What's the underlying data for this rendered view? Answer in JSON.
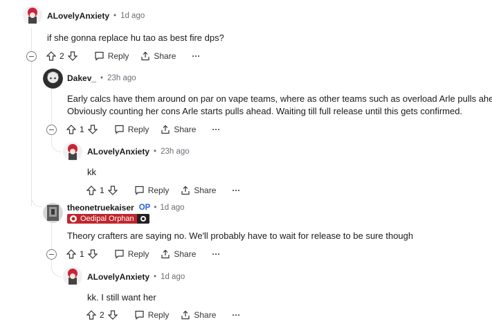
{
  "comments": [
    {
      "author": "ALovelyAnxiety",
      "time": "1d ago",
      "text": "if she gonna replace hu tao as best fire dps?",
      "votes": "2"
    },
    {
      "author": "Dakev_",
      "time": "23h ago",
      "lines": [
        "Early calcs have them around on par on vape teams, where as other teams such as overload Arle pulls ahead.",
        "Obviously counting her cons Arle starts pulls ahead. Waiting till full release until this gets confirmed."
      ],
      "votes": "1"
    },
    {
      "author": "ALovelyAnxiety",
      "time": "23h ago",
      "text": "kk",
      "votes": "1"
    },
    {
      "author": "theonetruekaiser",
      "op": "OP",
      "time": "1d ago",
      "flair": "Oedipal Orphan",
      "text": "Theory crafters are saying no. We'll probably have to wait for release to be sure though",
      "votes": "1"
    },
    {
      "author": "ALovelyAnxiety",
      "time": "1d ago",
      "text": "kk. I still want her",
      "votes": "2"
    }
  ],
  "actions": {
    "reply": "Reply",
    "share": "Share",
    "more": "···"
  },
  "separator": "•",
  "colors": {
    "flair": "#c0262d",
    "op": "#2a5bd7",
    "thread_line": "#e2e4e7"
  }
}
